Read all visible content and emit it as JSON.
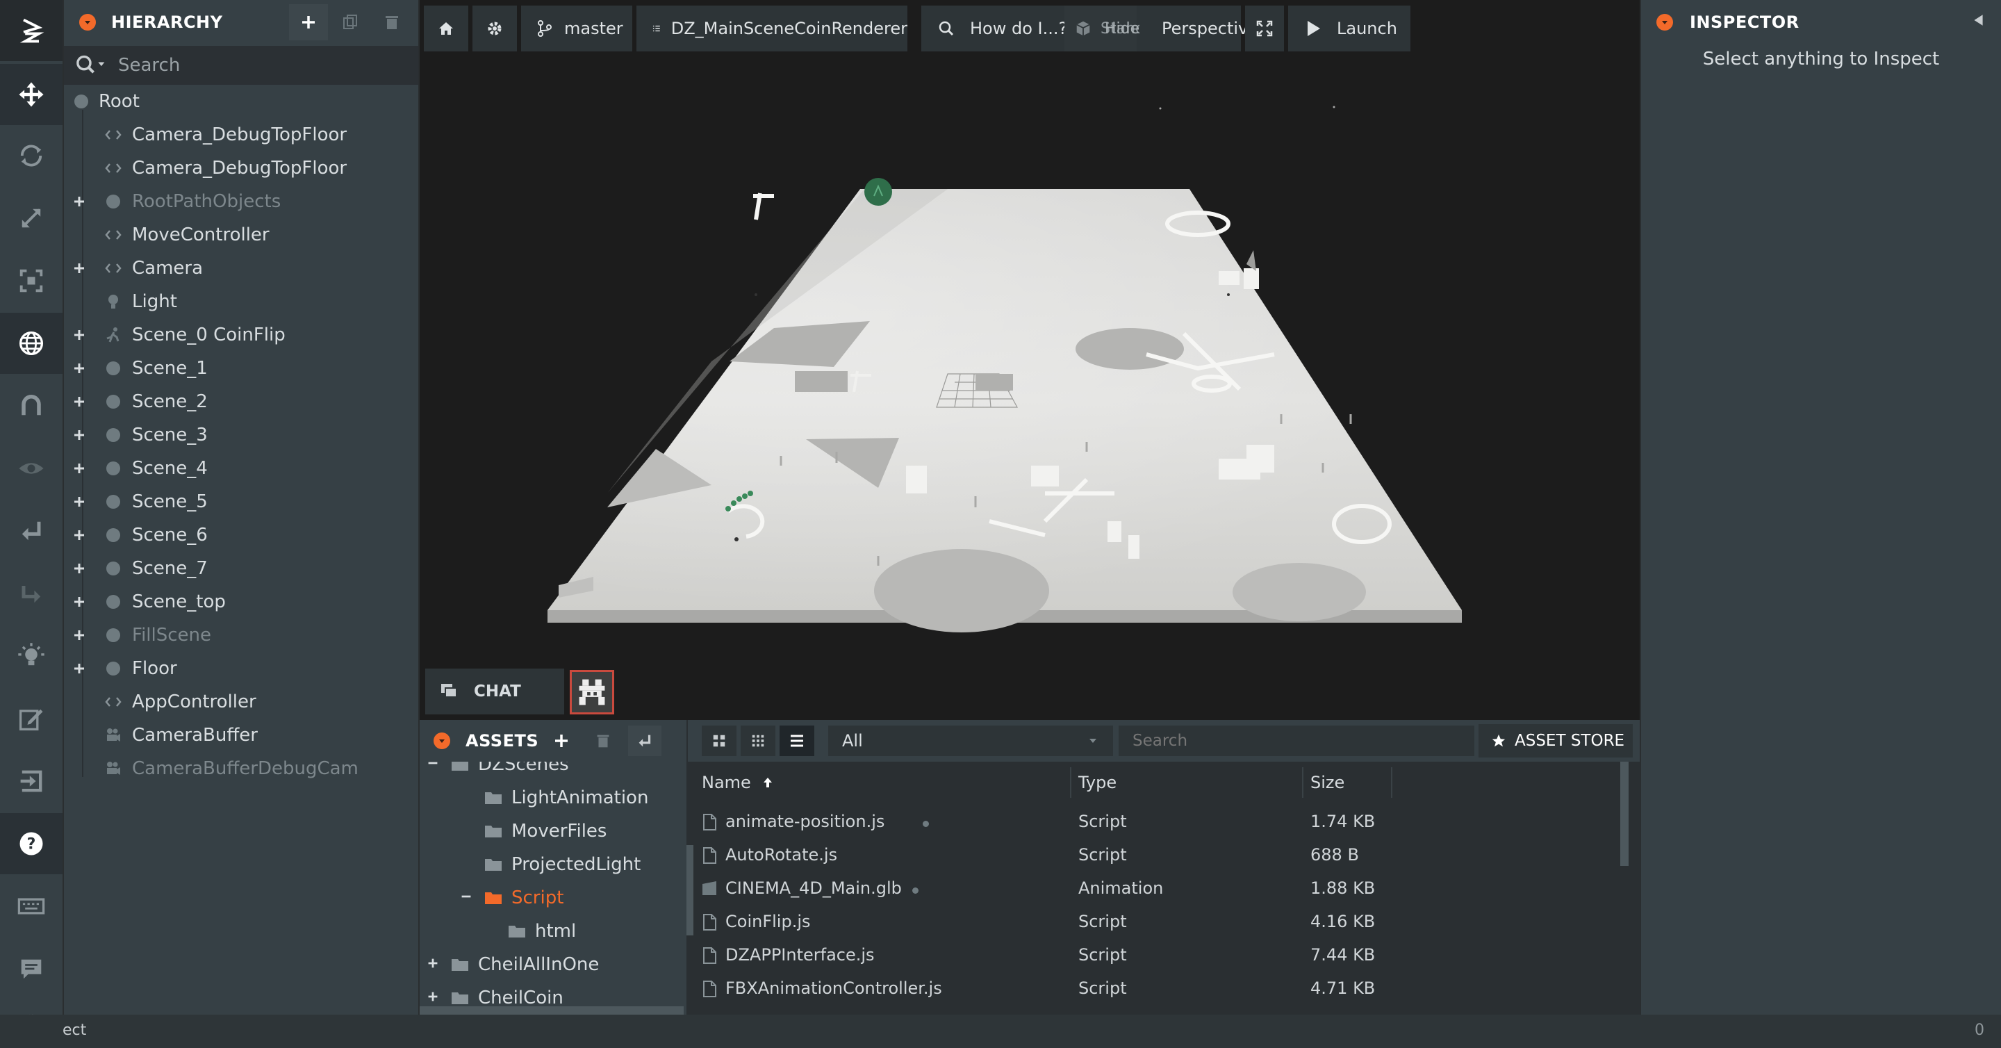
{
  "toolbar": {
    "tools": [
      "logo-icon",
      "move-icon",
      "rotate-icon",
      "scale-icon",
      "resize-icon",
      "world-icon",
      "snap-magnet-icon",
      "view-eye-icon",
      "undo-icon",
      "redo-icon",
      "light-bulb-icon",
      "edit-icon",
      "publish-icon",
      "help-icon",
      "keyboard-icon",
      "feedback-icon",
      "settings-icon"
    ]
  },
  "hierarchy": {
    "title": "HIERARCHY",
    "search_placeholder": "Search",
    "root": "Root",
    "items": [
      {
        "label": "Camera_DebugTopFloor",
        "icon": "entity-icon",
        "expandable": false,
        "dim": false
      },
      {
        "label": "Camera_DebugTopFloor",
        "icon": "entity-icon",
        "expandable": false,
        "dim": false
      },
      {
        "label": "RootPathObjects",
        "icon": "dot-icon",
        "expandable": true,
        "dim": true
      },
      {
        "label": "MoveController",
        "icon": "entity-icon",
        "expandable": false,
        "dim": false
      },
      {
        "label": "Camera",
        "icon": "entity-icon",
        "expandable": true,
        "dim": false
      },
      {
        "label": "Light",
        "icon": "light-icon",
        "expandable": false,
        "dim": false
      },
      {
        "label": "Scene_0 CoinFlip",
        "icon": "animation-icon",
        "expandable": true,
        "dim": false
      },
      {
        "label": "Scene_1",
        "icon": "dot-icon",
        "expandable": true,
        "dim": false
      },
      {
        "label": "Scene_2",
        "icon": "dot-icon",
        "expandable": true,
        "dim": false
      },
      {
        "label": "Scene_3",
        "icon": "dot-icon",
        "expandable": true,
        "dim": false
      },
      {
        "label": "Scene_4",
        "icon": "dot-icon",
        "expandable": true,
        "dim": false
      },
      {
        "label": "Scene_5",
        "icon": "dot-icon",
        "expandable": true,
        "dim": false
      },
      {
        "label": "Scene_6",
        "icon": "dot-icon",
        "expandable": true,
        "dim": false
      },
      {
        "label": "Scene_7",
        "icon": "dot-icon",
        "expandable": true,
        "dim": false
      },
      {
        "label": "Scene_top",
        "icon": "dot-icon",
        "expandable": true,
        "dim": false
      },
      {
        "label": "FillScene",
        "icon": "dot-icon",
        "expandable": true,
        "dim": true
      },
      {
        "label": "Floor",
        "icon": "dot-icon",
        "expandable": true,
        "dim": false
      },
      {
        "label": "AppController",
        "icon": "entity-icon",
        "expandable": false,
        "dim": false
      },
      {
        "label": "CameraBuffer",
        "icon": "camera-icon",
        "expandable": false,
        "dim": false
      },
      {
        "label": "CameraBufferDebugCam",
        "icon": "camera-icon",
        "expandable": false,
        "dim": true
      }
    ]
  },
  "viewport": {
    "branch": "master",
    "scene_name": "DZ_MainSceneCoinRenderer",
    "help_search": "How do I...?",
    "standard": "Standard",
    "hide": "Hide",
    "camera": "Perspective",
    "launch": "Launch"
  },
  "chat": {
    "label": "CHAT"
  },
  "assets": {
    "title": "ASSETS",
    "filter": "All",
    "search_placeholder": "Search",
    "store": "ASSET STORE",
    "folders": [
      {
        "label": "DZScenes",
        "indent": 1,
        "expanded": true,
        "selected": false
      },
      {
        "label": "LightAnimation",
        "indent": 2,
        "expanded": false,
        "selected": false
      },
      {
        "label": "MoverFiles",
        "indent": 2,
        "expanded": false,
        "selected": false
      },
      {
        "label": "ProjectedLight",
        "indent": 2,
        "expanded": false,
        "selected": false
      },
      {
        "label": "Script",
        "indent": 2,
        "expanded": true,
        "selected": true
      },
      {
        "label": "html",
        "indent": 3,
        "expanded": false,
        "selected": false
      },
      {
        "label": "CheilAllInOne",
        "indent": 1,
        "expanded": false,
        "selected": false
      },
      {
        "label": "CheilCoin",
        "indent": 1,
        "expanded": false,
        "selected": false
      }
    ],
    "columns": {
      "name": "Name",
      "type": "Type",
      "size": "Size"
    },
    "files": [
      {
        "name": "animate-position.js",
        "type": "Script",
        "size": "1.74 KB",
        "marked": true
      },
      {
        "name": "AutoRotate.js",
        "type": "Script",
        "size": "688 B",
        "marked": false
      },
      {
        "name": "CINEMA_4D_Main.glb",
        "type": "Animation",
        "size": "1.88 KB",
        "marked": true
      },
      {
        "name": "CoinFlip.js",
        "type": "Script",
        "size": "4.16 KB",
        "marked": false
      },
      {
        "name": "DZAPPInterface.js",
        "type": "Script",
        "size": "7.44 KB",
        "marked": false
      },
      {
        "name": "FBXAnimationController.js",
        "type": "Script",
        "size": "4.71 KB",
        "marked": false
      }
    ]
  },
  "inspector": {
    "title": "INSPECTOR",
    "empty": "Select anything to Inspect"
  },
  "statusbar": {
    "left": "ect",
    "right": "0"
  },
  "colors": {
    "accent": "#f36a2a",
    "panel": "#364045",
    "viewport": "#1c1c1c"
  }
}
